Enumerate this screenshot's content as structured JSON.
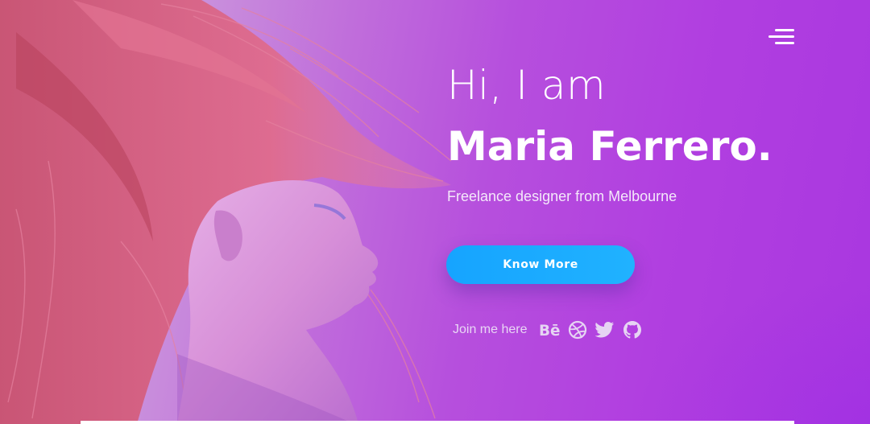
{
  "header": {
    "menu_icon": "hamburger-menu-icon"
  },
  "hero": {
    "greeting": "Hi, I am",
    "name": "Maria Ferrero.",
    "tagline": "Freelance designer from Melbourne",
    "cta_label": "Know More",
    "cta_color": "#1aa9ff"
  },
  "social": {
    "label": "Join me here",
    "links": [
      {
        "name": "Behance",
        "icon": "behance-icon"
      },
      {
        "name": "Dribbble",
        "icon": "dribbble-icon"
      },
      {
        "name": "Twitter",
        "icon": "twitter-icon"
      },
      {
        "name": "GitHub",
        "icon": "github-icon"
      }
    ]
  },
  "colors": {
    "background_start": "#c9a3de",
    "background_end": "#a937e0",
    "hair": "#d85f86",
    "text": "#ffffff"
  }
}
